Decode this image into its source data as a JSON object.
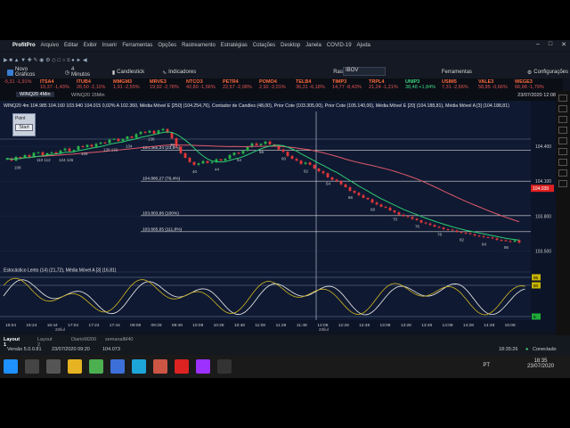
{
  "app": {
    "name": "ProfitPro",
    "menu": [
      "Arquivo",
      "Editar",
      "Exibir",
      "Inserir",
      "Ferramentas",
      "Opções",
      "Rastreamento",
      "Estratégias",
      "Cotações",
      "Desktop",
      "Janela",
      "COVID-19",
      "Ajuda"
    ]
  },
  "toolbar": {
    "novo_graficos": "Novo Gráficos",
    "interval": "4 Minutos",
    "chart_type": "Candlestick",
    "indicadores": "Indicadores",
    "rastreamento": "Rastreamento",
    "symbol": "IBOV",
    "ferramentas": "Ferramentas",
    "configuracoes": "Configurações"
  },
  "ticker": [
    {
      "sym": "",
      "val": "-5,31 -1,91%",
      "up": false
    },
    {
      "sym": "ITSA4",
      "val": "10,37 -1,43%",
      "up": false
    },
    {
      "sym": "ITUB4",
      "val": "26,50 -2,11%",
      "up": false
    },
    {
      "sym": "MMGM3",
      "val": "1,91 -2,55%",
      "up": false
    },
    {
      "sym": "MRVE3",
      "val": "19,92 -2,78%",
      "up": false
    },
    {
      "sym": "NTCO3",
      "val": "42,80 -1,56%",
      "up": false
    },
    {
      "sym": "PETR4",
      "val": "22,57 -2,08%",
      "up": false
    },
    {
      "sym": "POMO4",
      "val": "2,92 -2,01%",
      "up": false
    },
    {
      "sym": "TELB4",
      "val": "36,31 -6,18%",
      "up": false
    },
    {
      "sym": "TIMP3",
      "val": "14,77 -8,43%",
      "up": false
    },
    {
      "sym": "TRPL4",
      "val": "21,24 -1,21%",
      "up": false
    },
    {
      "sym": "UNIP3",
      "val": "38,48 +1,84%",
      "up": true
    },
    {
      "sym": "USIM5",
      "val": "7,31 -2,66%",
      "up": false
    },
    {
      "sym": "VALE3",
      "val": "58,85 -0,66%",
      "up": false
    },
    {
      "sym": "WEGE3",
      "val": "66,98 -1,79%",
      "up": false
    }
  ],
  "tabs": {
    "active": "WINQ20 4Min",
    "other": "WINQ20 15Min",
    "datetime": "23/07/2020 12:08"
  },
  "chart_header": "WINQ20 4m  104.985  104.160  103.940  104.015  0,02%  A 102.360,  Média Móvel E [250] (104.254,76), Contador de Candles (48,00), Prior Cote (103.305,00), Prior Cote (105.140,00), Média Móvel E [20] (104.188,81), Média Móvel A [3] (104.188,81)",
  "start_widget": {
    "title": "Point",
    "button": "Start"
  },
  "price_axis": {
    "ticks": [
      "104.400",
      "104.100",
      "103.800",
      "103.500"
    ],
    "current": "104.039"
  },
  "levels": [
    {
      "label": "104.365,24 (23,6%)",
      "price": 104365
    },
    {
      "label": "104.880,27 (76,4%)",
      "price": 104100
    },
    {
      "label": "103.803,86 (100%)",
      "price": 103804
    },
    {
      "label": "103.665,65 (111,8%)",
      "price": 103666
    }
  ],
  "candle_counts": [
    "108",
    "110 112",
    "124 126",
    "128",
    "130 132",
    "134",
    "136",
    "30",
    "40",
    "44",
    "54",
    "56",
    "60",
    "62",
    "64",
    "66",
    "68",
    "70",
    "76",
    "78",
    "82",
    "84",
    "86"
  ],
  "oscillator": {
    "label": "Estocástico Lento (14) (21,72),  Média Móvel A [3] (16,81)",
    "badges": [
      "95",
      "80",
      "8"
    ]
  },
  "time_axis": [
    "16:04",
    "16:24",
    "16:44",
    "17:04",
    "17:24",
    "17:44",
    "09:08",
    "09:28",
    "09:48",
    "10:08",
    "10:28",
    "10:48",
    "11:08",
    "11:28",
    "11:48",
    "12:08",
    "12:28",
    "12:48",
    "13:08",
    "13:28",
    "13:48",
    "14:08",
    "14:28",
    "14:48",
    "15:08"
  ],
  "date_labels": [
    "22/jul",
    "23/jul"
  ],
  "layouts": [
    "Layout 1",
    "Layout 2",
    "DiarioM200",
    "semanalM40"
  ],
  "status": {
    "version": "Versão 5.0.0.81",
    "date": "23/07/2020 09:20",
    "count": "104.073",
    "time": "18:35:26",
    "connected": "Conectado"
  },
  "taskbar": {
    "lang": "PT",
    "time": "18:35",
    "date": "23/07/2020",
    "icons": [
      "windows-icon",
      "search-icon",
      "task-view-icon",
      "folder-icon",
      "chrome-icon",
      "store-icon",
      "edge-icon",
      "paint-icon",
      "opera-icon",
      "premiere-icon",
      "obs-icon"
    ]
  },
  "colors": {
    "bg": "#0f1932",
    "up": "#29b34a",
    "down": "#e33838",
    "ema250": "#e05a6a",
    "ema20": "#2ecc71",
    "current": "#e02020"
  }
}
